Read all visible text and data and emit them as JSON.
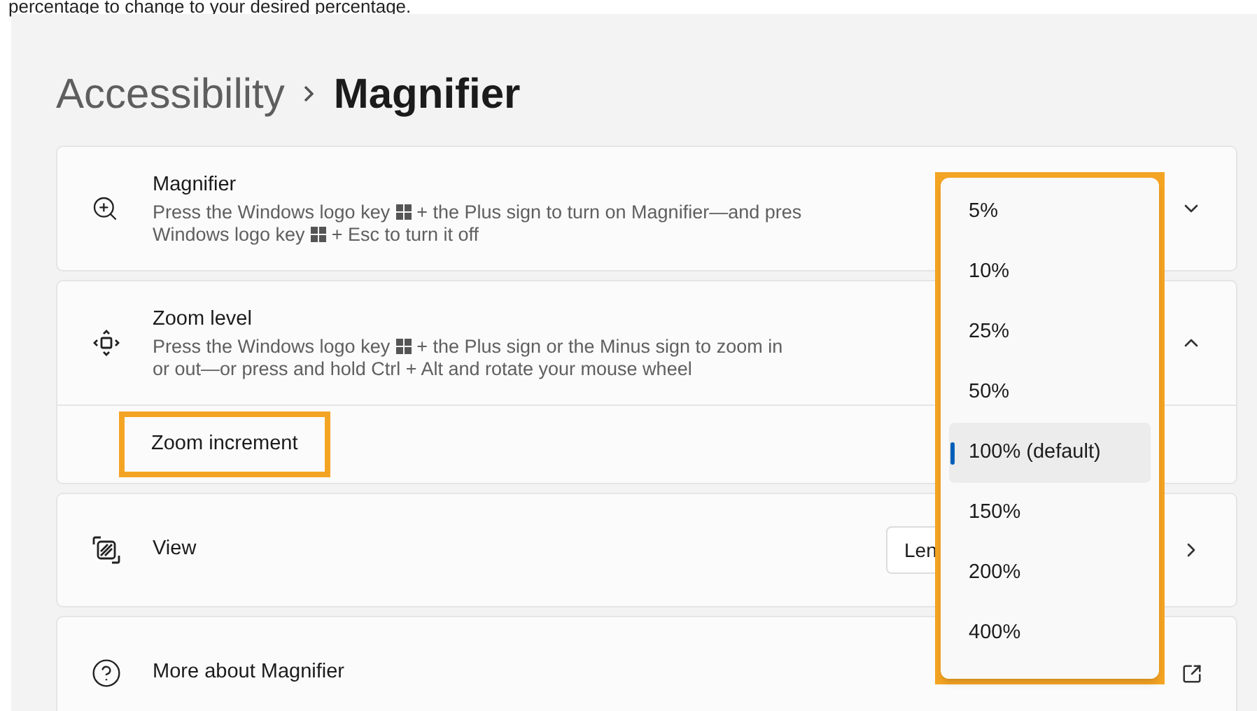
{
  "caption": "percentage to change to your desired percentage.",
  "breadcrumb": {
    "parent": "Accessibility",
    "current": "Magnifier"
  },
  "settings": [
    {
      "kind": "expander",
      "title": "Magnifier",
      "expanded": false,
      "description_lines": [
        [
          {
            "kind": "text",
            "text": "Press the Windows logo key"
          },
          {
            "kind": "key"
          },
          {
            "kind": "text",
            "text": "+ the Plus sign to turn on Magnifier—and pres"
          }
        ],
        [
          {
            "kind": "text",
            "text": "Windows logo key"
          },
          {
            "kind": "key"
          },
          {
            "kind": "text",
            "text": "+ Esc to turn it off"
          }
        ]
      ]
    },
    {
      "kind": "expander",
      "title": "Zoom level",
      "expanded": true,
      "description_lines": [
        [
          {
            "kind": "text",
            "text": "Press the Windows logo key"
          },
          {
            "kind": "key"
          },
          {
            "kind": "text",
            "text": "+ the Plus sign or the Minus sign to zoom in"
          }
        ],
        [
          {
            "kind": "text",
            "text": "or out—or press and hold Ctrl + Alt and rotate your mouse wheel"
          }
        ]
      ],
      "children": [
        {
          "label": "Zoom increment",
          "highlighted": true
        }
      ]
    },
    {
      "kind": "nav",
      "title": "View",
      "value": "Len"
    },
    {
      "kind": "link",
      "title": "More about Magnifier"
    }
  ],
  "dropdown": {
    "highlighted": true,
    "options": [
      {
        "label": "5%",
        "selected": false
      },
      {
        "label": "10%",
        "selected": false
      },
      {
        "label": "25%",
        "selected": false
      },
      {
        "label": "50%",
        "selected": false
      },
      {
        "label": "100% (default)",
        "selected": true
      },
      {
        "label": "150%",
        "selected": false
      },
      {
        "label": "200%",
        "selected": false
      },
      {
        "label": "400%",
        "selected": false
      }
    ]
  }
}
